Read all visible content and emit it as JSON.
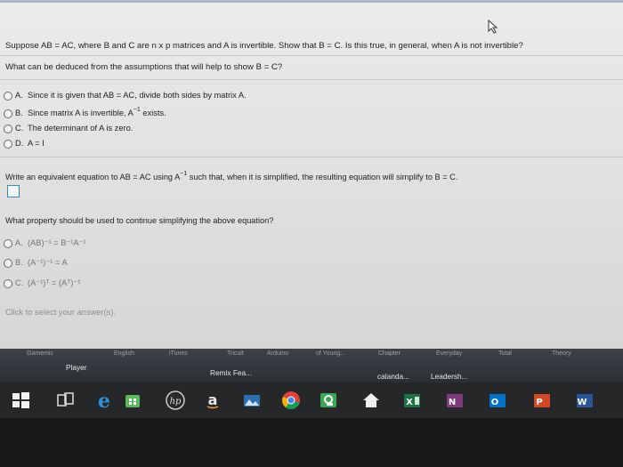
{
  "problem": {
    "question": "Suppose AB = AC, where B and C are n x p matrices and A is invertible. Show that B = C. Is this true, in general, when A is not invertible?",
    "prompt": "What can be deduced from the assumptions that will help to show B = C?"
  },
  "part1": {
    "options": [
      {
        "letter": "A.",
        "text": "Since it is given that AB = AC, divide both sides by matrix A."
      },
      {
        "letter": "B.",
        "text_pre": "Since matrix A is invertible, A",
        "sup": "−1",
        "text_post": " exists."
      },
      {
        "letter": "C.",
        "text": "The determinant of A is zero."
      },
      {
        "letter": "D.",
        "text": "A = I"
      }
    ]
  },
  "part2": {
    "prompt_pre": "Write an equivalent equation to AB = AC using A",
    "prompt_sup": "−1",
    "prompt_post": " such that, when it is simplified, the resulting equation will simplify to B = C."
  },
  "part3": {
    "prompt": "What property should be used to continue simplifying the above equation?",
    "options": [
      {
        "letter": "A.",
        "text": "(AB)⁻¹ = B⁻¹A⁻¹"
      },
      {
        "letter": "B.",
        "text": "(A⁻¹)⁻¹ = A"
      },
      {
        "letter": "C.",
        "text": "(A⁻¹)ᵀ = (Aᵀ)⁻¹"
      }
    ]
  },
  "footer": {
    "hint": "Click to select your answer(s)."
  },
  "appbar": {
    "top_labels": [
      "Gamemic",
      "English",
      "iTunes",
      "Tricuit",
      "Arduino",
      "of Young...",
      "Chapter",
      "Everyday",
      "Total",
      "Theory"
    ],
    "items": [
      "Player",
      "Remix Fea...",
      "calanda...",
      "Leadersh..."
    ]
  },
  "taskbar": {
    "icons": [
      "windows-start",
      "task-view",
      "edge",
      "store",
      "hp",
      "amazon",
      "photos",
      "chrome",
      "classroom",
      "home",
      "excel",
      "onenote",
      "outlook",
      "powerpoint",
      "word"
    ]
  }
}
